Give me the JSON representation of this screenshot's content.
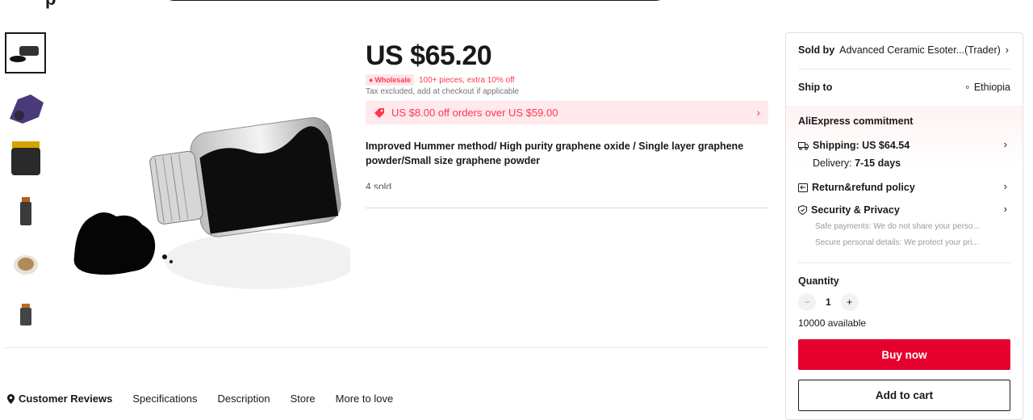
{
  "header": {
    "logo_fragment": "p"
  },
  "product": {
    "price": "US $65.20",
    "wholesale_badge": "Wholesale",
    "wholesale_text": "100+ pieces, extra 10% off",
    "tax_note": "Tax excluded, add at checkout if applicable",
    "coupon_text": "US $8.00 off orders over US $59.00",
    "title": "Improved Hummer method/ High purity graphene oxide / Single layer graphene powder/Small size graphene powder",
    "sold": "4 sold"
  },
  "tabs": [
    {
      "label": "Customer Reviews"
    },
    {
      "label": "Specifications"
    },
    {
      "label": "Description"
    },
    {
      "label": "Store"
    },
    {
      "label": "More to love"
    }
  ],
  "sidebar": {
    "sold_by_label": "Sold by",
    "seller": "Advanced Ceramic Esoter...(Trader)",
    "ship_to_label": "Ship to",
    "ship_to_value": "Ethiopia",
    "commitment_title": "AliExpress commitment",
    "shipping": "Shipping: US $64.54",
    "delivery_label": "Delivery:",
    "delivery_value": "7-15 days",
    "return_policy": "Return&refund policy",
    "security": "Security & Privacy",
    "security_sub1": "Safe payments: We do not share your perso...",
    "security_sub2": "Secure personal details: We protect your pri...",
    "quantity_label": "Quantity",
    "quantity_value": "1",
    "available": "10000 available",
    "buy_now": "Buy now",
    "add_to_cart": "Add to cart"
  },
  "colors": {
    "accent": "#e6002d",
    "coupon_bg": "#ffe9ec",
    "coupon_text": "#fd384f"
  }
}
